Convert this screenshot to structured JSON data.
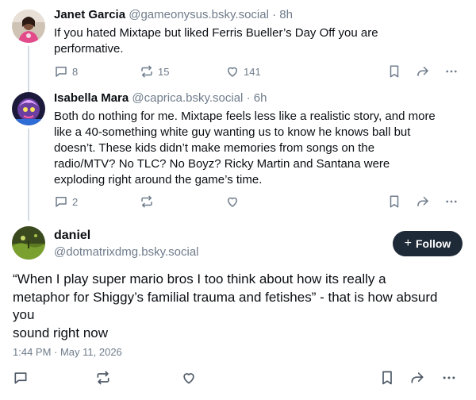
{
  "posts": [
    {
      "author": "Janet Garcia",
      "handle": "@gameonysus.bsky.social",
      "separator": "·",
      "time": "8h",
      "text_lines": [
        "If you hated Mixtape but liked Ferris Bueller’s Day Off you are",
        "performative."
      ],
      "replies": "8",
      "reposts": "15",
      "likes": "141"
    },
    {
      "author": "Isabella Mara",
      "handle": "@caprica.bsky.social",
      "separator": "·",
      "time": "6h",
      "text_lines": [
        "Both do nothing for me. Mixtape feels less like a realistic story, and more",
        "like a 40-something white guy wanting us to know he knows ball but",
        "doesn’t. These kids didn’t make memories from songs on the",
        "radio/MTV? No TLC? No Boyz? Ricky Martin and Santana were",
        "exploding right around the game’s time."
      ],
      "replies": "2"
    }
  ],
  "main_post": {
    "author": "daniel",
    "handle": "@dotmatrixdmg.bsky.social",
    "follow_label": "Follow",
    "follow_plus": "+",
    "text": "“When I play super mario bros I too think about how its really a\nmetaphor for Shiggy’s familial trauma and fetishes” - that is how absurd\nyou\nsound right now",
    "timestamp": "1:44 PM · May 11, 2026"
  },
  "icons": {
    "reply": "reply-icon",
    "repost": "repost-icon",
    "like": "heart-icon",
    "bookmark": "bookmark-icon",
    "share": "share-icon",
    "more": "more-icon"
  },
  "colors": {
    "text": "#0b0f14",
    "muted": "#6f7c8b",
    "follow_bg": "#1e2a38",
    "thread_line": "#d4dbe2"
  }
}
